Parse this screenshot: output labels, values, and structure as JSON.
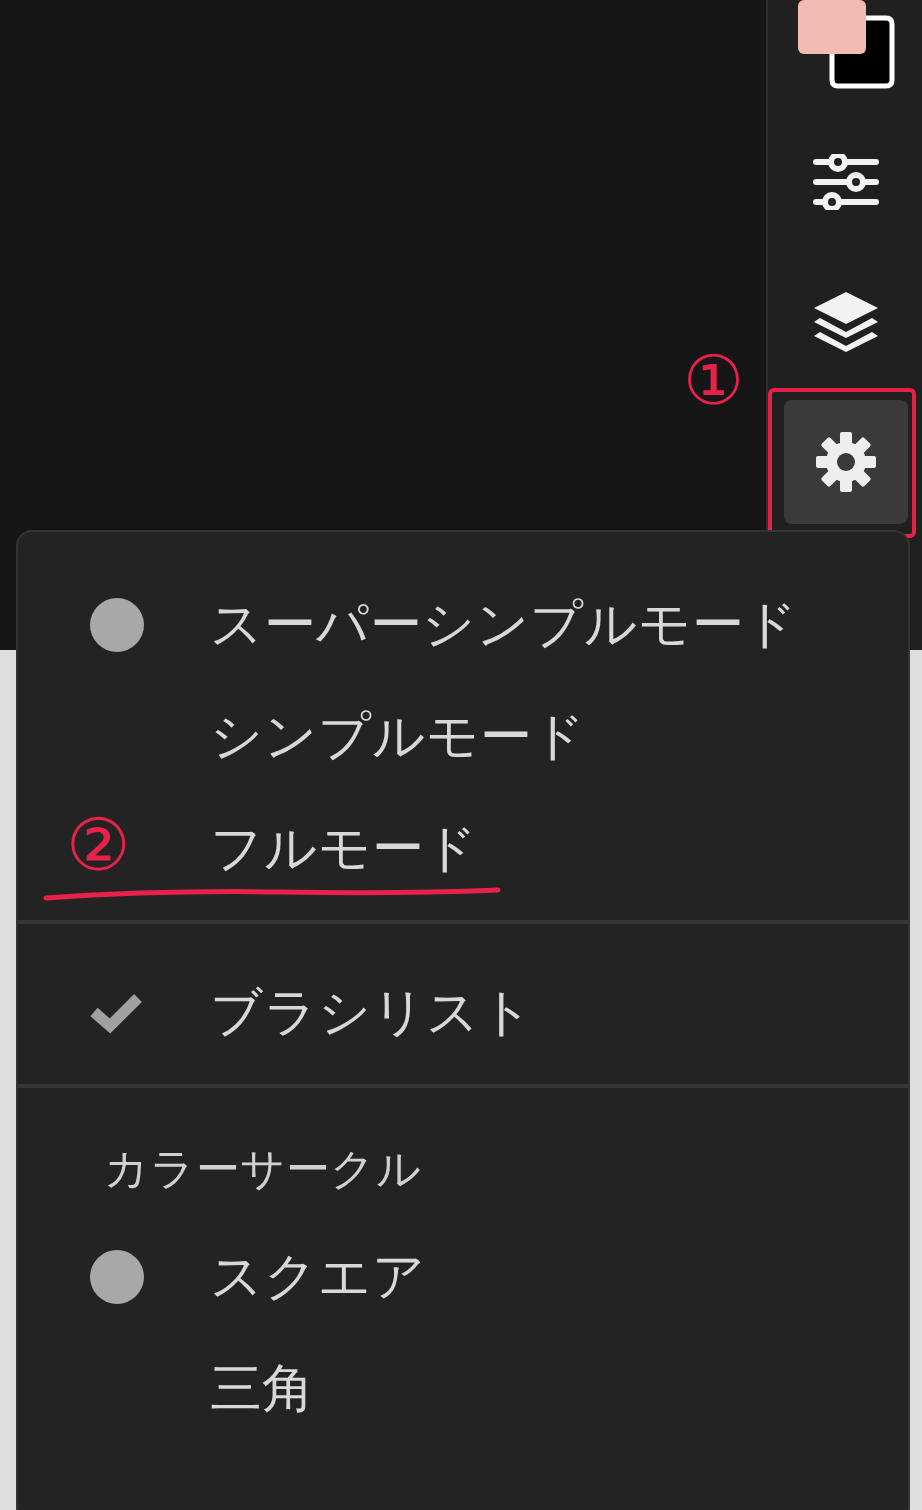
{
  "toolbar": {
    "swatches": [
      {
        "color": "#f2bcb3"
      },
      {
        "color": "#000000"
      }
    ],
    "tools": [
      {
        "kind": "sliders",
        "selected": false
      },
      {
        "kind": "layers",
        "selected": false
      },
      {
        "kind": "settings",
        "selected": true,
        "annotation": "①",
        "boxed": true
      }
    ]
  },
  "menu": {
    "sections": [
      {
        "items": [
          {
            "kind": "radio",
            "label": "スーパーシンプルモード",
            "selected": true
          },
          {
            "kind": "radio",
            "label": "シンプルモード",
            "selected": false
          },
          {
            "kind": "radio",
            "label": "フルモード",
            "selected": false,
            "annotation": "②",
            "underlined": true
          }
        ]
      },
      {
        "items": [
          {
            "kind": "check",
            "label": "ブラシリスト",
            "checked": true
          }
        ]
      },
      {
        "header": "カラーサークル",
        "items": [
          {
            "kind": "radio",
            "label": "スクエア",
            "selected": true
          },
          {
            "kind": "radio",
            "label": "三角",
            "selected": false
          }
        ]
      }
    ]
  }
}
